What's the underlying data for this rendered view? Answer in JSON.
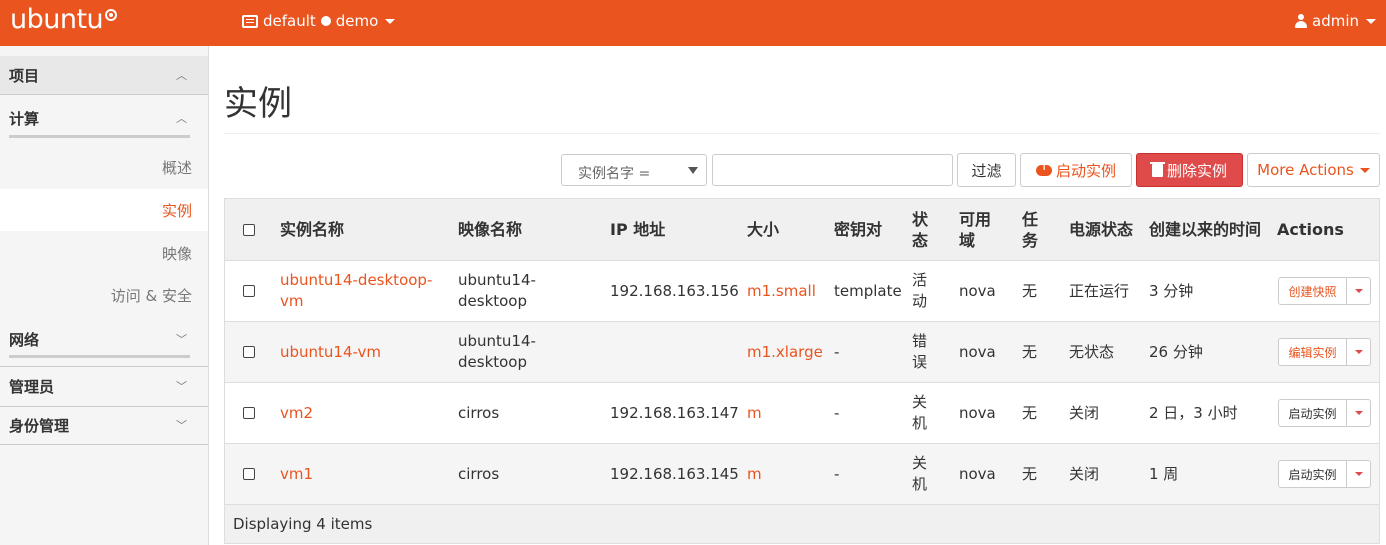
{
  "topbar": {
    "logo": "ubuntu",
    "project_domain": "default",
    "project_name": "demo",
    "user": "admin"
  },
  "sidebar": {
    "project": "项目",
    "compute": "计算",
    "items": [
      "概述",
      "实例",
      "映像",
      "访问 & 安全"
    ],
    "network": "网络",
    "admin": "管理员",
    "identity": "身份管理"
  },
  "page": {
    "title": "实例"
  },
  "toolbar": {
    "filter_field": "实例名字 =",
    "filter_value": "",
    "filter_button": "过滤",
    "launch_button": "启动实例",
    "delete_button": "删除实例",
    "more_button": "More Actions"
  },
  "table": {
    "headers": {
      "name": "实例名称",
      "image": "映像名称",
      "ip": "IP 地址",
      "size": "大小",
      "keypair": "密钥对",
      "status": "状态",
      "az": "可用域",
      "task": "任务",
      "power": "电源状态",
      "uptime": "创建以来的时间",
      "actions": "Actions"
    },
    "rows": [
      {
        "name": "ubuntu14-desktoop-vm",
        "image": "ubuntu14-desktoop",
        "ip": "192.168.163.156",
        "size": "m1.small",
        "keypair": "template",
        "status": "活动",
        "az": "nova",
        "task": "无",
        "power": "正在运行",
        "uptime": "3 分钟",
        "action": "创建快照",
        "action_style": "orange"
      },
      {
        "name": "ubuntu14-vm",
        "image": "ubuntu14-desktoop",
        "ip": "",
        "size": "m1.xlarge",
        "keypair": "-",
        "status": "错误",
        "az": "nova",
        "task": "无",
        "power": "无状态",
        "uptime": "26 分钟",
        "action": "编辑实例",
        "action_style": "orange"
      },
      {
        "name": "vm2",
        "image": "cirros",
        "ip": "192.168.163.147",
        "size": "m",
        "keypair": "-",
        "status": "关机",
        "az": "nova",
        "task": "无",
        "power": "关闭",
        "uptime": "2 日，3 小时",
        "action": "启动实例",
        "action_style": "dark"
      },
      {
        "name": "vm1",
        "image": "cirros",
        "ip": "192.168.163.145",
        "size": "m",
        "keypair": "-",
        "status": "关机",
        "az": "nova",
        "task": "无",
        "power": "关闭",
        "uptime": "1 周",
        "action": "启动实例",
        "action_style": "dark"
      }
    ],
    "footer": "Displaying 4 items"
  },
  "colors": {
    "brand": "#e9541f",
    "danger": "#df4b4b"
  },
  "icons": [
    "list-icon",
    "user-icon",
    "cloud-upload-icon",
    "trash-icon",
    "chevron-up-icon",
    "chevron-down-icon",
    "caret-down-icon"
  ]
}
